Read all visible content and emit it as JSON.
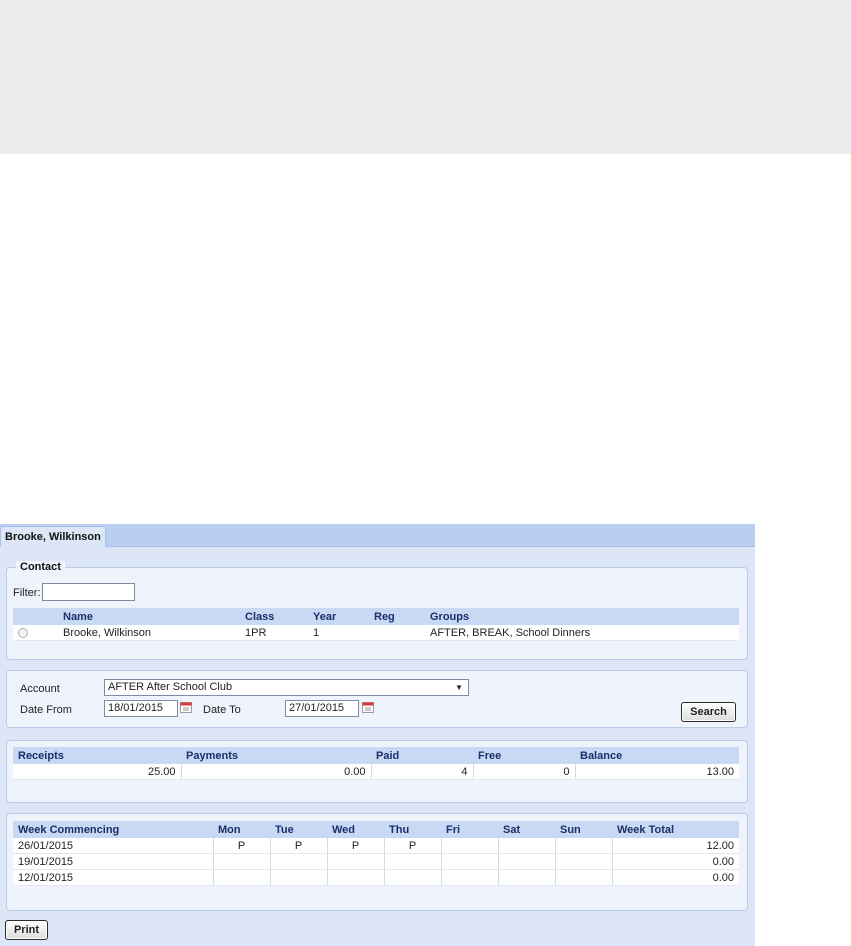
{
  "tab": {
    "label": "Brooke, Wilkinson"
  },
  "contact": {
    "legend": "Contact",
    "filter_label": "Filter:",
    "filter_value": "",
    "columns": [
      "",
      "Name",
      "Class",
      "Year",
      "Reg",
      "Groups"
    ],
    "rows": [
      {
        "name": "Brooke, Wilkinson",
        "class": "1PR",
        "year": "1",
        "reg": "",
        "groups": "AFTER, BREAK, School Dinners"
      }
    ]
  },
  "search": {
    "account_label": "Account",
    "account_value": "AFTER After School Club",
    "date_from_label": "Date From",
    "date_from_value": "18/01/2015",
    "date_to_label": "Date To",
    "date_to_value": "27/01/2015",
    "search_label": "Search"
  },
  "summary": {
    "columns": [
      "Receipts",
      "Payments",
      "Paid",
      "Free",
      "Balance"
    ],
    "values": [
      "25.00",
      "0.00",
      "4",
      "0",
      "13.00"
    ]
  },
  "weeks": {
    "columns": [
      "Week Commencing",
      "Mon",
      "Tue",
      "Wed",
      "Thu",
      "Fri",
      "Sat",
      "Sun",
      "Week Total"
    ],
    "rows": [
      {
        "week": "26/01/2015",
        "mon": "P",
        "tue": "P",
        "wed": "P",
        "thu": "P",
        "fri": "",
        "sat": "",
        "sun": "",
        "total": "12.00"
      },
      {
        "week": "19/01/2015",
        "mon": "",
        "tue": "",
        "wed": "",
        "thu": "",
        "fri": "",
        "sat": "",
        "sun": "",
        "total": "0.00"
      },
      {
        "week": "12/01/2015",
        "mon": "",
        "tue": "",
        "wed": "",
        "thu": "",
        "fri": "",
        "sat": "",
        "sun": "",
        "total": "0.00"
      }
    ]
  },
  "print_label": "Print",
  "colors": {
    "header_bg": "#c7d9f3",
    "header_text": "#1b2f6b",
    "panel_bg": "#dce6f7",
    "tab_strip": "#b9cff0"
  }
}
